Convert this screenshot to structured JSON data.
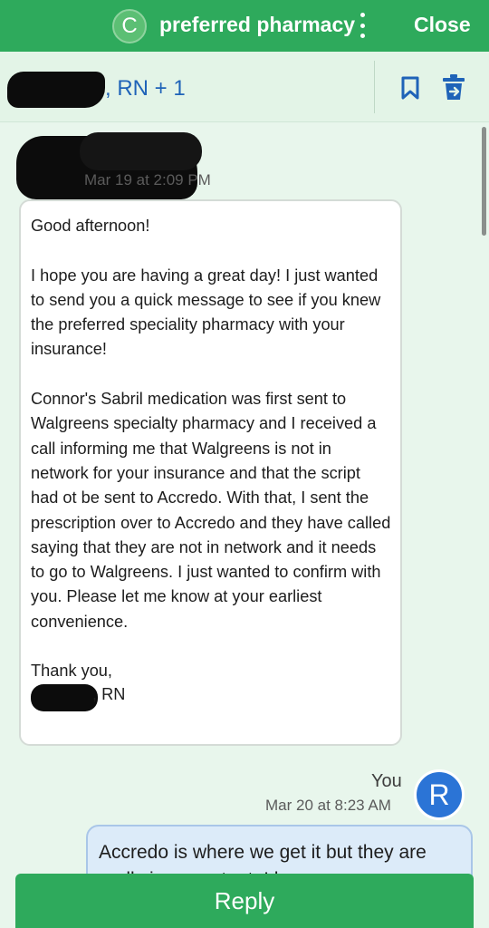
{
  "topbar": {
    "badge_letter": "C",
    "title": "preferred pharmacy",
    "close_label": "Close"
  },
  "header": {
    "participants_suffix": ", RN + 1"
  },
  "message_in": {
    "timestamp": "Mar 19 at 2:09 PM",
    "body": "Good afternoon!\n\nI hope you are having a great day! I just wanted to send you a quick message to see if you knew the preferred speciality pharmacy with your insurance!\n\nConnor's Sabril medication was first sent to Walgreens specialty pharmacy and I received a call informing me that Walgreens is not in network for your insurance and that the script had ot be sent to Accredo. With that, I sent the prescription over to Accredo and they have called saying that they are not in network and it needs to go to Walgreens. I just wanted to confirm with you. Please let me know at your earliest convenience.\n\nThank you,",
    "signature_suffix": ", RN"
  },
  "message_out": {
    "sender": "You",
    "avatar_letter": "R",
    "timestamp": "Mar 20 at 8:23 AM",
    "body": "Accredo is where we get it but they are really incompetent. I have no"
  },
  "reply_label": "Reply",
  "colors": {
    "brand_green": "#2eaa5c",
    "link_blue": "#1f63b8",
    "avatar_blue": "#2b74d6",
    "background": "#e8f6ec"
  },
  "icons": {
    "bookmark": "bookmark-icon",
    "trash": "trash-icon",
    "more": "kebab-menu-icon"
  }
}
